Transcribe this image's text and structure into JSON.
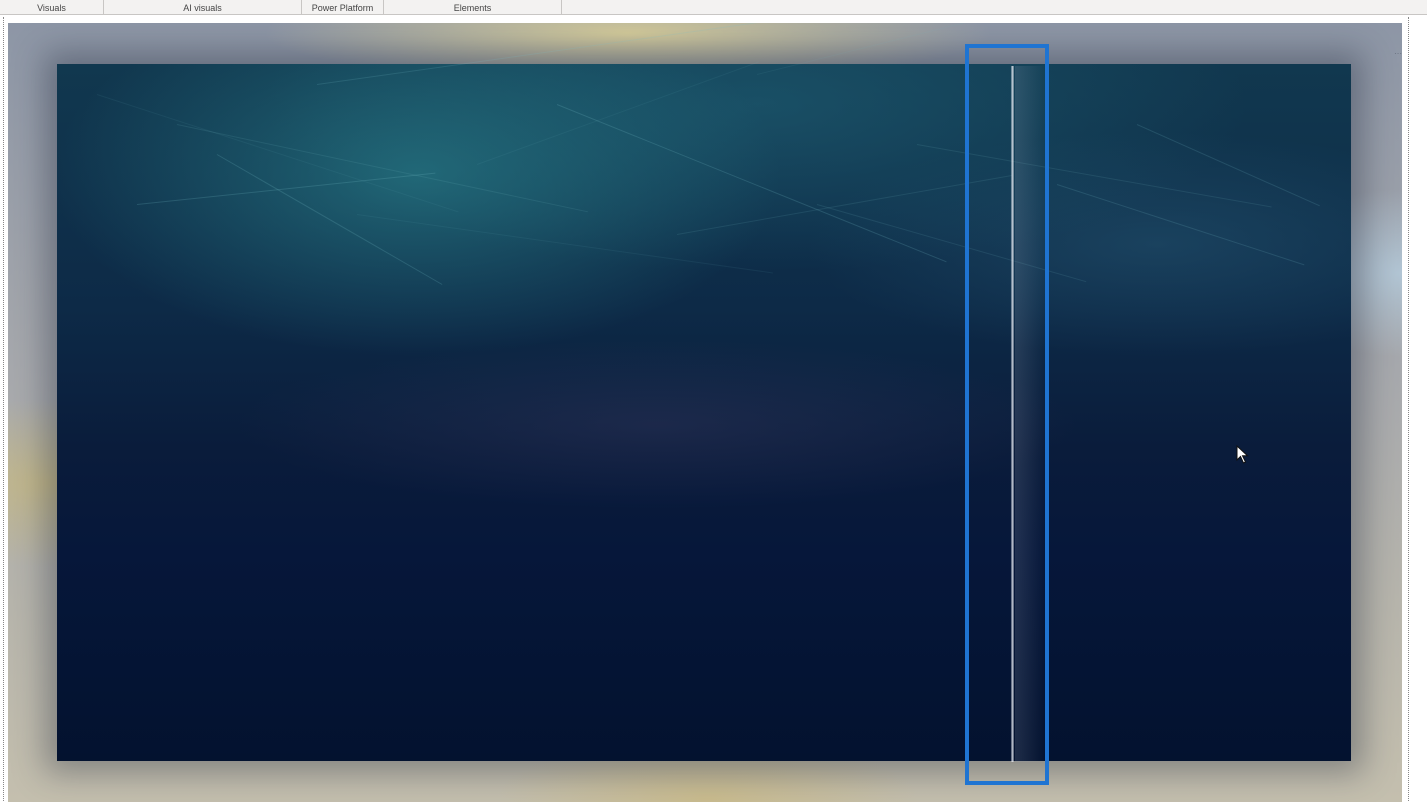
{
  "ribbon": {
    "groups": [
      {
        "label": "Visuals"
      },
      {
        "label": "AI visuals"
      },
      {
        "label": "Power Platform"
      },
      {
        "label": "Elements"
      }
    ]
  },
  "report_page": {
    "background_image": "space-nebula",
    "slider_visual": "vertical-slider",
    "highlight_color": "#1f74d2",
    "cursor_icon": "mouse-pointer-icon"
  },
  "colors": {
    "ribbon_bg": "#f3f2f1",
    "canvas_dark": "#03122f",
    "nebula_teal": "#2a828c",
    "highlight": "#1f74d2"
  }
}
